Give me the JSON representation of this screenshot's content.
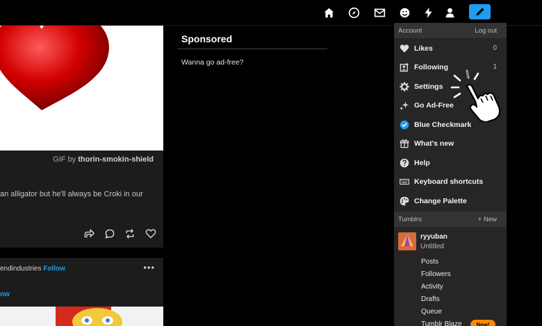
{
  "topbar": {
    "icons": [
      "home-icon",
      "explore-icon",
      "inbox-icon",
      "messages-icon",
      "activity-icon",
      "account-icon",
      "compose-icon"
    ]
  },
  "post1": {
    "gif_credit_prefix": "GIF by",
    "gif_credit_user": "thorin-smokin-shield",
    "caption": "an alligator but he'll always be Croki in our"
  },
  "post2": {
    "author": "endindustries",
    "follow": "Follow",
    "follow2": "ow",
    "more": "•••"
  },
  "sponsored": {
    "title": "Sponsored",
    "text": "Wanna go ad-free?"
  },
  "menu": {
    "account_label": "Account",
    "logout_label": "Log out",
    "items": [
      {
        "label": "Likes",
        "count": "0",
        "icon": "heart-icon"
      },
      {
        "label": "Following",
        "count": "1",
        "icon": "following-icon"
      },
      {
        "label": "Settings",
        "count": "",
        "icon": "gear-icon"
      },
      {
        "label": "Go Ad-Free",
        "count": "",
        "icon": "sparkle-icon"
      },
      {
        "label": "Blue Checkmark",
        "count": "",
        "icon": "checkmark-badge-icon"
      },
      {
        "label": "What's new",
        "count": "",
        "icon": "gift-icon"
      },
      {
        "label": "Help",
        "count": "",
        "icon": "help-icon"
      },
      {
        "label": "Keyboard shortcuts",
        "count": "",
        "icon": "keyboard-icon"
      },
      {
        "label": "Change Palette",
        "count": "",
        "icon": "palette-icon"
      }
    ],
    "tumblrs_label": "Tumblrs",
    "new_label": "+ New",
    "blog": {
      "name": "ryyuban",
      "title": "Untitled"
    },
    "blog_items": [
      "Posts",
      "Followers",
      "Activity",
      "Drafts",
      "Queue",
      "Tumblr Blaze"
    ],
    "new_badge": "New!"
  },
  "colors": {
    "accent": "#1f9cf0",
    "menu_bg": "#262626",
    "section_bg": "#333333",
    "badge": "#ff8a00"
  }
}
